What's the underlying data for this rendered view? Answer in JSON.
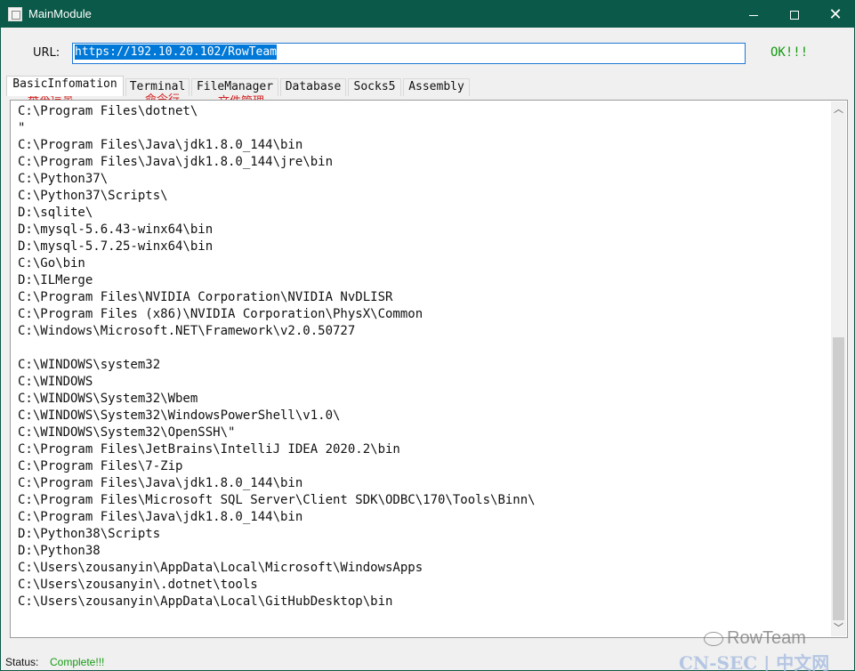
{
  "window": {
    "title": "MainModule"
  },
  "url": {
    "label": "URL:",
    "value": "https://192.10.20.102/RowTeam",
    "status": "OK!!!"
  },
  "tabs": [
    {
      "label": "BasicInfomation",
      "annotation": "基本信息"
    },
    {
      "label": "Terminal",
      "annotation": "命令行"
    },
    {
      "label": "FileManager",
      "annotation": "文件管理"
    },
    {
      "label": "Database"
    },
    {
      "label": "Socks5"
    },
    {
      "label": "Assembly"
    }
  ],
  "output_lines": [
    "C:\\Program Files\\dotnet\\",
    "\"",
    "C:\\Program Files\\Java\\jdk1.8.0_144\\bin",
    "C:\\Program Files\\Java\\jdk1.8.0_144\\jre\\bin",
    "C:\\Python37\\",
    "C:\\Python37\\Scripts\\",
    "D:\\sqlite\\",
    "D:\\mysql-5.6.43-winx64\\bin",
    "D:\\mysql-5.7.25-winx64\\bin",
    "C:\\Go\\bin",
    "D:\\ILMerge",
    "C:\\Program Files\\NVIDIA Corporation\\NVIDIA NvDLISR",
    "C:\\Program Files (x86)\\NVIDIA Corporation\\PhysX\\Common",
    "C:\\Windows\\Microsoft.NET\\Framework\\v2.0.50727",
    "",
    "C:\\WINDOWS\\system32",
    "C:\\WINDOWS",
    "C:\\WINDOWS\\System32\\Wbem",
    "C:\\WINDOWS\\System32\\WindowsPowerShell\\v1.0\\",
    "C:\\WINDOWS\\System32\\OpenSSH\\\"",
    "C:\\Program Files\\JetBrains\\IntelliJ IDEA 2020.2\\bin",
    "C:\\Program Files\\7-Zip",
    "C:\\Program Files\\Java\\jdk1.8.0_144\\bin",
    "C:\\Program Files\\Microsoft SQL Server\\Client SDK\\ODBC\\170\\Tools\\Binn\\",
    "C:\\Program Files\\Java\\jdk1.8.0_144\\bin",
    "D:\\Python38\\Scripts",
    "D:\\Python38",
    "C:\\Users\\zousanyin\\AppData\\Local\\Microsoft\\WindowsApps",
    "C:\\Users\\zousanyin\\.dotnet\\tools",
    "C:\\Users\\zousanyin\\AppData\\Local\\GitHubDesktop\\bin"
  ],
  "status": {
    "label": "Status:",
    "value": "Complete!!!"
  },
  "watermarks": {
    "primary": "RowTeam",
    "secondary": "CN-SEC | 中文网"
  }
}
